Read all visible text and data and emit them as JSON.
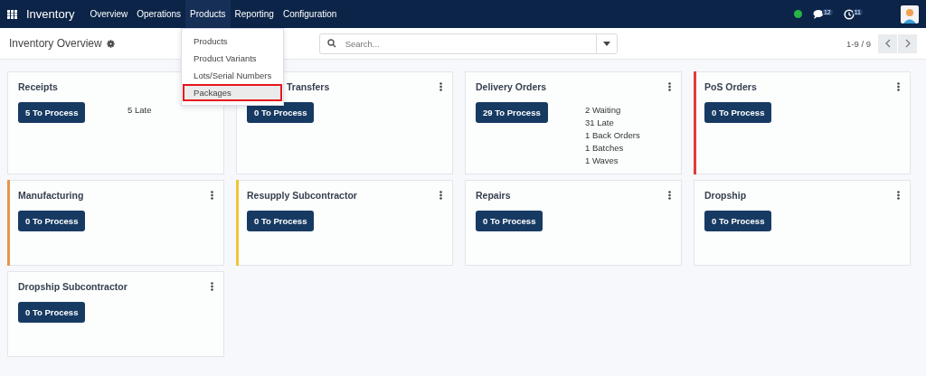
{
  "navbar": {
    "app_name": "Inventory",
    "menus": [
      {
        "label": "Overview",
        "open": false
      },
      {
        "label": "Operations",
        "open": false
      },
      {
        "label": "Products",
        "open": true
      },
      {
        "label": "Reporting",
        "open": false
      },
      {
        "label": "Configuration",
        "open": false
      }
    ],
    "messages_count": "12",
    "activities_count": "11"
  },
  "dropdown": {
    "items": [
      {
        "label": "Products",
        "selected": false
      },
      {
        "label": "Product Variants",
        "selected": false
      },
      {
        "label": "Lots/Serial Numbers",
        "selected": false
      },
      {
        "label": "Packages",
        "selected": true
      }
    ]
  },
  "control_panel": {
    "title": "Inventory Overview",
    "search": {
      "placeholder": "Search..."
    },
    "pager": "1-9 / 9"
  },
  "cards": [
    {
      "title": "Receipts",
      "menu_icon": false,
      "button": "5 To Process",
      "stats": [
        "5 Late"
      ]
    },
    {
      "title": "Transfers",
      "menu_icon": true,
      "under_menu": true,
      "button": "0 To Process"
    },
    {
      "title": "Delivery Orders",
      "menu_icon": true,
      "button": "29 To Process",
      "stats": [
        "2 Waiting",
        "31 Late",
        "1 Back Orders",
        "1 Batches",
        "1 Waves"
      ]
    },
    {
      "title": "PoS Orders",
      "menu_icon": true,
      "color": "#e03c3c",
      "button": "0 To Process"
    },
    {
      "title": "Manufacturing",
      "menu_icon": true,
      "color": "#e8954a",
      "button": "0 To Process"
    },
    {
      "title": "Resupply Subcontractor",
      "menu_icon": true,
      "color": "#f0c43a",
      "button": "0 To Process"
    },
    {
      "title": "Repairs",
      "menu_icon": true,
      "button": "0 To Process"
    },
    {
      "title": "Dropship",
      "menu_icon": true,
      "button": "0 To Process"
    },
    {
      "title": "Dropship Subcontractor",
      "menu_icon": true,
      "button": "0 To Process"
    }
  ]
}
